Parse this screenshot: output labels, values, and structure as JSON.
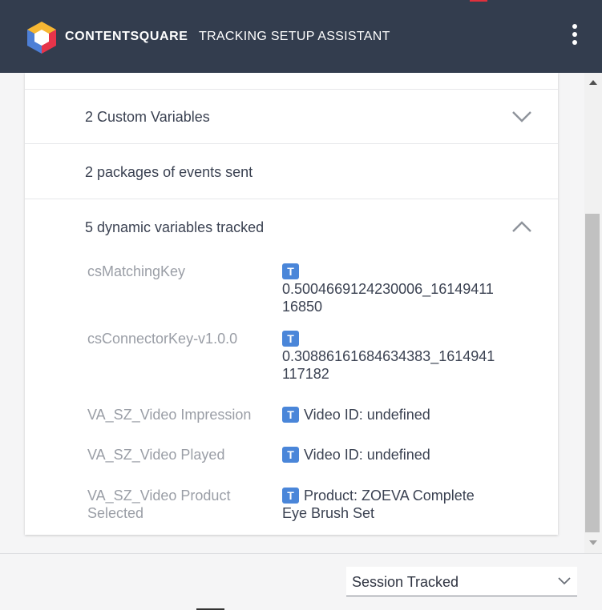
{
  "header": {
    "brand": "CONTENTSQUARE",
    "subtitle": "TRACKING SETUP ASSISTANT",
    "menu_icon": "kebab-menu-icon",
    "bg_color": "#333d4e"
  },
  "sections": {
    "custom_variables": {
      "label": "2 Custom Variables",
      "icon": "chevron-down-icon"
    },
    "packages": {
      "label": "2 packages of events sent"
    },
    "dynamic_variables": {
      "label": "5 dynamic variables tracked",
      "icon": "chevron-up-icon",
      "type_badge": "T",
      "items": [
        {
          "key": "csMatchingKey",
          "value": "0.5004669124230006_1614941116850"
        },
        {
          "key": "csConnectorKey-v1.0.0",
          "value": "0.30886161684634383_1614941117182"
        },
        {
          "key": "VA_SZ_Video Impression",
          "value": "Video ID: undefined"
        },
        {
          "key": "VA_SZ_Video Played",
          "value": "Video ID: undefined"
        },
        {
          "key": "VA_SZ_Video Product Selected",
          "value": "Product: ZOEVA Complete Eye Brush Set"
        }
      ]
    }
  },
  "footer": {
    "select_value": "Session Tracked",
    "select_icon": "chevron-down-icon"
  },
  "colors": {
    "badge": "#4a86d9",
    "key_text": "#9a9ea6"
  }
}
